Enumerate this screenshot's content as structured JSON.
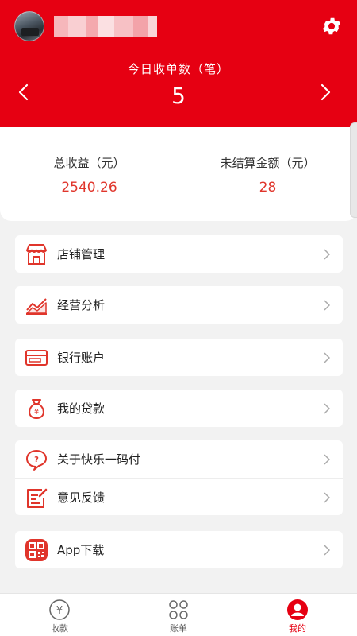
{
  "header": {
    "today_label": "今日收单数（笔）",
    "today_value": "5"
  },
  "summary": {
    "total_label": "总收益（元）",
    "total_value": "2540.26",
    "unsettled_label": "未结算金额（元）",
    "unsettled_value": "28"
  },
  "menu": {
    "store": "店铺管理",
    "analysis": "经营分析",
    "bank": "银行账户",
    "loan": "我的贷款",
    "about": "关于快乐一码付",
    "feedback": "意见反馈",
    "app_download": "App下载"
  },
  "tabbar": {
    "collect": "收款",
    "bills": "账单",
    "mine": "我的"
  },
  "colors": {
    "brand_red": "#e60012",
    "value_red": "#e0352b"
  },
  "icons": [
    "settings-gear-icon",
    "chevron-left-icon",
    "chevron-right-icon",
    "store-icon",
    "trend-chart-icon",
    "bank-card-icon",
    "money-bag-icon",
    "question-bubble-icon",
    "feedback-note-icon",
    "qr-code-icon",
    "yen-circle-icon",
    "grid-icon",
    "user-icon"
  ]
}
